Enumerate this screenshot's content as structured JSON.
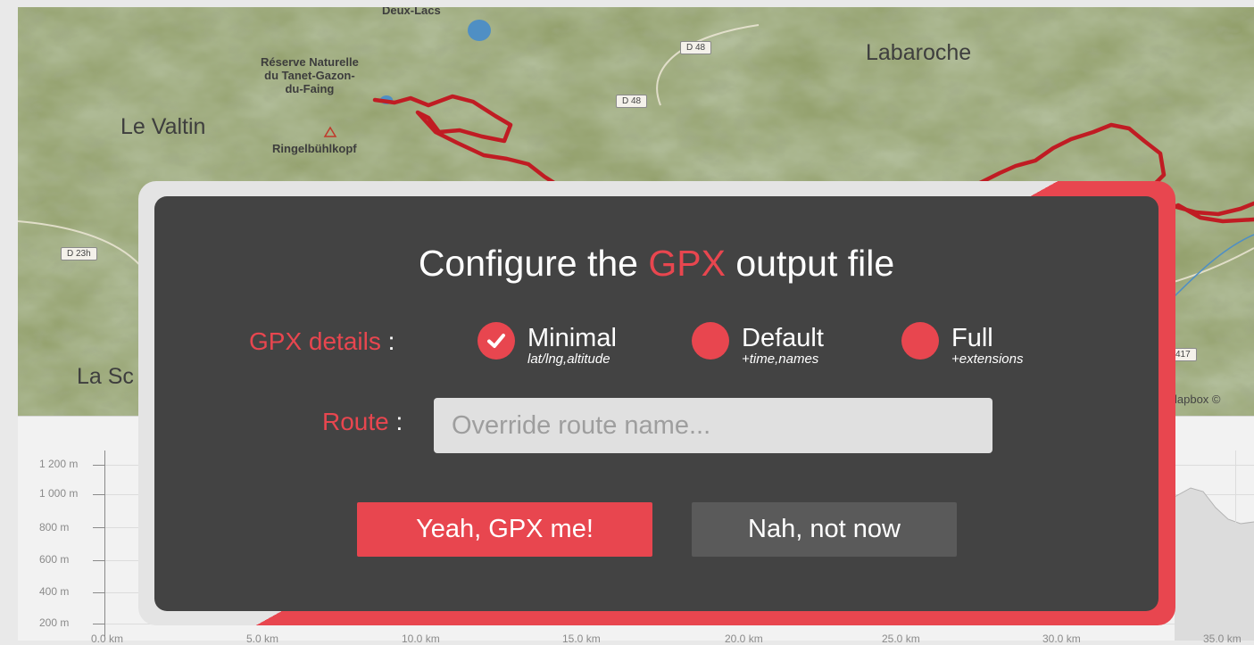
{
  "map": {
    "places": {
      "deux_lacs": "Deux-Lacs",
      "labaroche": "Labaroche",
      "reserve": [
        "Réserve Naturelle",
        "du Tanet-Gazon-",
        "du-Faing"
      ],
      "le_valtin": "Le Valtin",
      "ringelbuhlkopf": "Ringelbühlkopf",
      "la_sc": "La Sc"
    },
    "roads": {
      "d48_top": "D 48",
      "d48_mid": "D 48",
      "d23h": "D 23h",
      "d417": "417"
    },
    "attribution": "lapbox ©",
    "route_color": "#c01c23"
  },
  "elevation": {
    "y_labels": [
      "1 200 m",
      "1 000 m",
      "800 m",
      "600 m",
      "400 m",
      "200 m"
    ],
    "x_labels": [
      "0.0 km",
      "5.0 km",
      "10.0 km",
      "15.0 km",
      "20.0 km",
      "25.0 km",
      "30.0 km",
      "35.0 km"
    ]
  },
  "modal": {
    "title": {
      "prefix": "Configure the ",
      "accent": "GPX",
      "suffix": " output file"
    },
    "details_label": "GPX details",
    "colon": ":",
    "options": [
      {
        "name": "Minimal",
        "sub": "lat/lng,altitude",
        "selected": true
      },
      {
        "name": "Default",
        "sub": "+time,names",
        "selected": false
      },
      {
        "name": "Full",
        "sub": "+extensions",
        "selected": false
      }
    ],
    "route_label": "Route",
    "route_placeholder": "Override route name...",
    "route_value": "",
    "confirm_label": "Yeah, GPX me!",
    "cancel_label": "Nah, not now"
  },
  "colors": {
    "accent": "#e8464f",
    "modal_bg": "#434343",
    "secondary_button": "#5a5a5a"
  }
}
